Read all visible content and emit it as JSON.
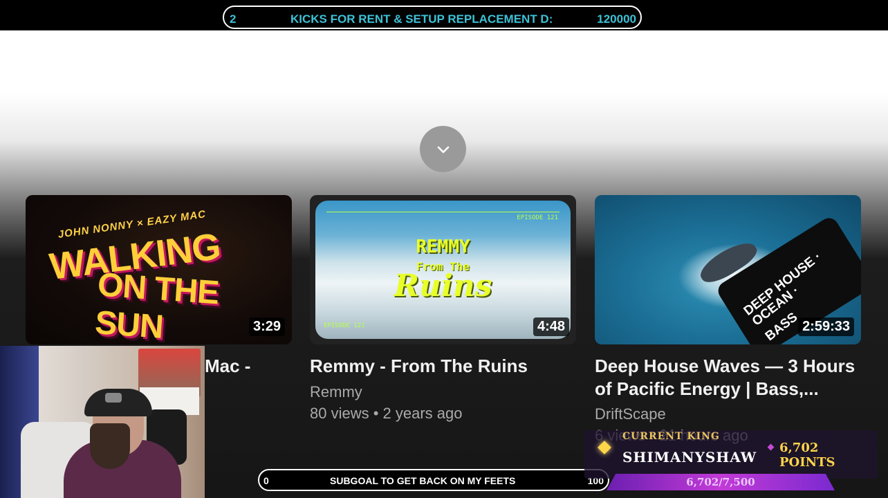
{
  "overlay": {
    "top_goal": {
      "current": "2",
      "label": "KICKS FOR RENT & SETUP REPLACEMENT D:",
      "target": "120000"
    },
    "bottom_goal": {
      "current": "0",
      "label": "SUBGOAL TO GET BACK ON MY FEETS",
      "target": "100"
    },
    "king": {
      "label": "CURRENT KING",
      "name": "SHIMANYSHAW",
      "points": "6,702 POINTS",
      "progress": "6,702/7,500"
    },
    "colors": {
      "goal_text": "#3ec1d6",
      "king_gold": "#ffd54a",
      "king_bar": "#c23ad6"
    }
  },
  "player": {
    "expand_icon": "chevron-down-icon"
  },
  "videos": [
    {
      "thumb_line_credits": "JOHN NONNY × EAZY MAC",
      "thumb_line1": "WALKING",
      "thumb_line2": "ON THE SUN",
      "duration": "3:29",
      "title_partial": "Mac -"
    },
    {
      "thumb_line1": "REMMY",
      "thumb_line2": "From The",
      "thumb_line3": "Ruins",
      "thumb_episode": "EPISODE 121",
      "duration": "4:48",
      "title": "Remmy - From The Ruins",
      "channel": "Remmy",
      "meta": "80 views • 2 years ago"
    },
    {
      "thumb_lines": [
        "DEEP HOUSE ·",
        "OCEAN ·",
        "BASS"
      ],
      "duration": "2:59:33",
      "title_line1": "Deep House Waves — 3 Hours",
      "title_line2": "of Pacific Energy | Bass,...",
      "channel": "DriftScape",
      "meta": "6 views • 21 hours ago"
    }
  ]
}
